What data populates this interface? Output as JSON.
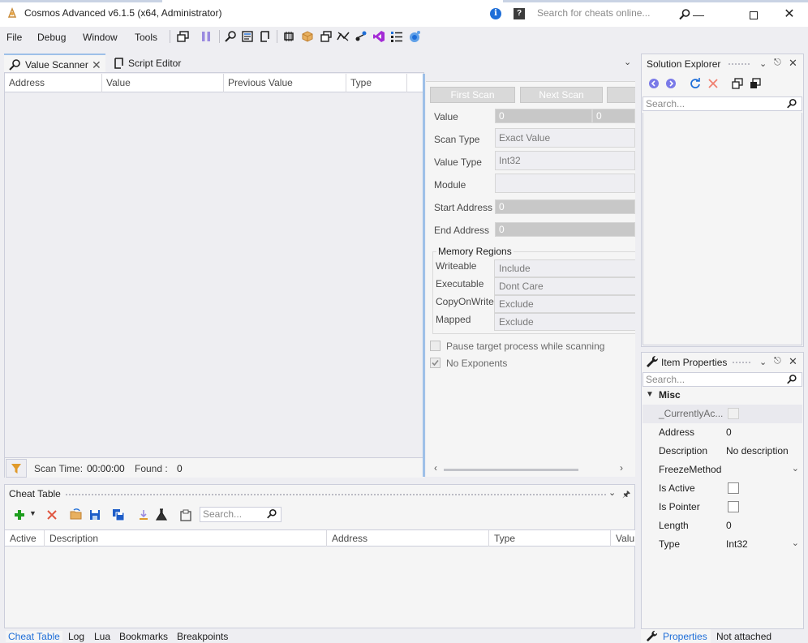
{
  "window": {
    "title": "Cosmos Advanced v6.1.5 (x64, Administrator)",
    "search_placeholder": "Search for cheats online...",
    "info_icon": "info-icon",
    "help_icon": "help-icon"
  },
  "menu": [
    "File",
    "Debug",
    "Window",
    "Tools"
  ],
  "doc_tabs": {
    "value_scanner": "Value Scanner",
    "script_editor": "Script Editor"
  },
  "results_columns": [
    "Address",
    "Value",
    "Previous Value",
    "Type"
  ],
  "scan_status": {
    "scan_time_label": "Scan Time:",
    "scan_time_value": "00:00:00",
    "found_label": "Found :",
    "found_value": "0"
  },
  "scan_panel": {
    "first_scan": "First Scan",
    "next_scan": "Next Scan",
    "value_label": "Value",
    "value_from": "0",
    "value_to": "0",
    "scan_type_label": "Scan Type",
    "scan_type_value": "Exact Value",
    "value_type_label": "Value Type",
    "value_type_value": "Int32",
    "module_label": "Module",
    "module_value": "",
    "start_address_label": "Start Address",
    "start_address_value": "0",
    "end_address_label": "End Address",
    "end_address_value": "0",
    "memory_regions_title": "Memory Regions",
    "regions": [
      {
        "label": "Writeable",
        "value": "Include"
      },
      {
        "label": "Executable",
        "value": "Dont Care"
      },
      {
        "label": "CopyOnWrite",
        "value": "Exclude"
      },
      {
        "label": "Mapped",
        "value": "Exclude"
      }
    ],
    "pause_target": "Pause target process while scanning",
    "pause_target_checked": false,
    "no_exponents": "No Exponents",
    "no_exponents_checked": true
  },
  "cheat_table": {
    "title": "Cheat Table",
    "search_placeholder": "Search...",
    "columns": [
      "Active",
      "Description",
      "Address",
      "Type",
      "Valu"
    ]
  },
  "bottom_tabs": [
    "Cheat Table",
    "Log",
    "Lua",
    "Bookmarks",
    "Breakpoints"
  ],
  "solution_explorer": {
    "title": "Solution Explorer",
    "search_placeholder": "Search..."
  },
  "item_properties": {
    "title": "Item Properties",
    "search_placeholder": "Search...",
    "category": "Misc",
    "rows": [
      {
        "name": "_CurrentlyAc...",
        "kind": "checkbox-disabled",
        "value": ""
      },
      {
        "name": "Address",
        "kind": "text",
        "value": "0"
      },
      {
        "name": "Description",
        "kind": "text",
        "value": "No description"
      },
      {
        "name": "FreezeMethod",
        "kind": "dropdown",
        "value": ""
      },
      {
        "name": "Is Active",
        "kind": "checkbox",
        "value": ""
      },
      {
        "name": "Is Pointer",
        "kind": "checkbox",
        "value": ""
      },
      {
        "name": "Length",
        "kind": "text",
        "value": "0"
      },
      {
        "name": "Type",
        "kind": "dropdown",
        "value": "Int32"
      }
    ]
  },
  "right_bottom_tabs": {
    "properties": "Properties",
    "not_attached": "Not attached"
  },
  "colors": {
    "accent_blue": "#1e6ed8",
    "add_green": "#1e9e1e",
    "remove_red": "#e0553f",
    "vs_purple": "#a42bd6"
  }
}
